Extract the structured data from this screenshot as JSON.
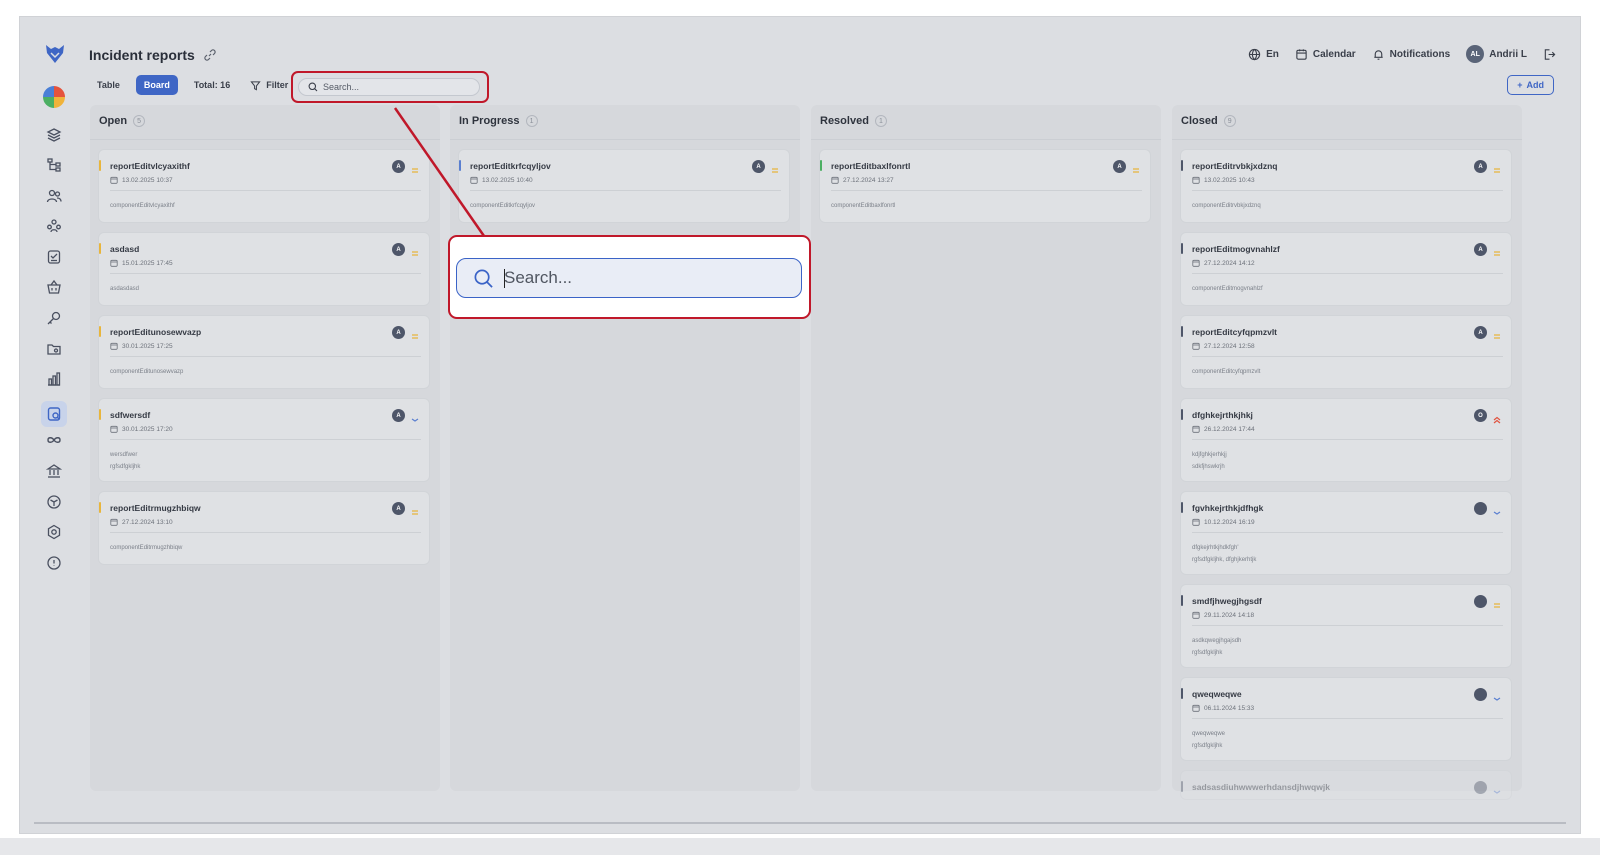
{
  "app": {
    "title": "Incident reports"
  },
  "header": {
    "language": "En",
    "calendar": "Calendar",
    "notifications": "Notifications",
    "user_initials": "AL",
    "user_name": "Andrii L"
  },
  "toolbar": {
    "table": "Table",
    "board": "Board",
    "total": "Total: 16",
    "filter": "Filter",
    "search_placeholder": "Search...",
    "add": "Add"
  },
  "callout": {
    "search_placeholder": "Search..."
  },
  "colors": {
    "accent": "#3f66c5",
    "highlight": "#c0182a",
    "prio_medium": "#e8b53c",
    "prio_high": "#e0533f",
    "prio_low": "#5a7fd0"
  },
  "columns": [
    {
      "name": "Open",
      "count": "5",
      "cards": [
        {
          "title": "reportEditvlcyaxithf",
          "date": "13.02.2025 10:37",
          "desc": [
            "componentEditvlcyaxithf"
          ],
          "avatar": "A",
          "bar": "#e8b53c",
          "prio": "medium"
        },
        {
          "title": "asdasd",
          "date": "15.01.2025 17:45",
          "desc": [
            "asdasdasd"
          ],
          "avatar": "A",
          "bar": "#e8b53c",
          "prio": "medium"
        },
        {
          "title": "reportEditunosewvazp",
          "date": "30.01.2025 17:25",
          "desc": [
            "componentEditunosewvazp"
          ],
          "avatar": "A",
          "bar": "#e8b53c",
          "prio": "medium"
        },
        {
          "title": "sdfwersdf",
          "date": "30.01.2025 17:20",
          "desc": [
            "wersdfwer",
            "rgfsdfgkljhk"
          ],
          "avatar": "A",
          "bar": "#e8b53c",
          "prio": "low"
        },
        {
          "title": "reportEditrmugzhbiqw",
          "date": "27.12.2024 13:10",
          "desc": [
            "componentEditrmugzhbiqw"
          ],
          "avatar": "A",
          "bar": "#e8b53c",
          "prio": "medium"
        }
      ]
    },
    {
      "name": "In Progress",
      "count": "1",
      "cards": [
        {
          "title": "reportEditkrfcqyljov",
          "date": "13.02.2025 10:40",
          "desc": [
            "componentEditkrfcqyljov"
          ],
          "avatar": "A",
          "bar": "#5a7fd0",
          "prio": "medium"
        }
      ]
    },
    {
      "name": "Resolved",
      "count": "1",
      "cards": [
        {
          "title": "reportEditbaxlfonrtl",
          "date": "27.12.2024 13:27",
          "desc": [
            "componentEditbaxlfonrtl"
          ],
          "avatar": "A",
          "bar": "#4caf63",
          "prio": "medium"
        }
      ]
    },
    {
      "name": "Closed",
      "count": "9",
      "cards": [
        {
          "title": "reportEditrvbkjxdznq",
          "date": "13.02.2025 10:43",
          "desc": [
            "componentEditrvbkjxdznq"
          ],
          "avatar": "A",
          "bar": "#4e5669",
          "prio": "medium"
        },
        {
          "title": "reportEditmogvnahlzf",
          "date": "27.12.2024 14:12",
          "desc": [
            "componentEditmogvnahlzf"
          ],
          "avatar": "A",
          "bar": "#4e5669",
          "prio": "medium"
        },
        {
          "title": "reportEditcyfqpmzvlt",
          "date": "27.12.2024 12:58",
          "desc": [
            "componentEditcyfqpmzvlt"
          ],
          "avatar": "A",
          "bar": "#4e5669",
          "prio": "medium"
        },
        {
          "title": "dfghkejrthkjhkj",
          "date": "26.12.2024 17:44",
          "desc": [
            "kdjfghkjerhkjj",
            "sdkfjhswkrjh"
          ],
          "avatar": "O",
          "bar": "#4e5669",
          "prio": "high"
        },
        {
          "title": "fgvhkejrthkjdfhgk",
          "date": "10.12.2024 16:19",
          "desc": [
            "dfgkejrhtkjhdkfgh'",
            "rgfsdfgkljhk, dfghjkerhtjk"
          ],
          "avatar": "",
          "bar": "#4e5669",
          "prio": "low"
        },
        {
          "title": "smdfjhwegjhgsdf",
          "date": "29.11.2024 14:18",
          "desc": [
            "asdkqwegjhgajsdh",
            "rgfsdfgkljhk"
          ],
          "avatar": "",
          "bar": "#4e5669",
          "prio": "medium"
        },
        {
          "title": "qweqweqwe",
          "date": "06.11.2024 15:33",
          "desc": [
            "qweqweqwe",
            "rgfsdfgkljhk"
          ],
          "avatar": "",
          "bar": "#4e5669",
          "prio": "low"
        },
        {
          "title": "sadsasdiuhwwwerhdansdjhwqwjk",
          "date": "",
          "desc": [],
          "avatar": "",
          "bar": "#4e5669",
          "prio": "low"
        }
      ]
    }
  ]
}
